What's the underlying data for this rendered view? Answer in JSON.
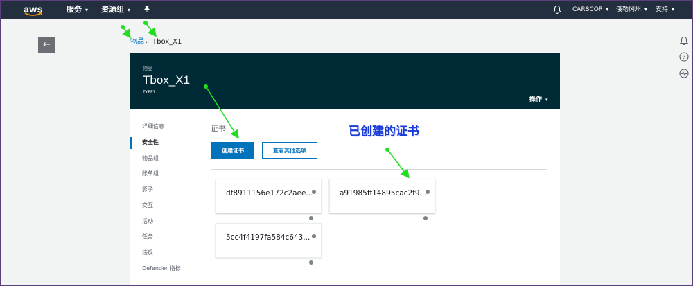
{
  "nav": {
    "logo_text": "aws",
    "services": "服务",
    "resource_groups": "资源组",
    "account": "CARSCOP",
    "region": "俄勒冈州",
    "support": "支持"
  },
  "breadcrumb": {
    "parent": "物品",
    "separator": "›",
    "current": "Tbox_X1"
  },
  "header": {
    "label": "物品",
    "title": "Tbox_X1",
    "type": "TYPE1",
    "actions": "操作"
  },
  "sidebar": {
    "items": [
      {
        "label": "详细信息"
      },
      {
        "label": "安全性"
      },
      {
        "label": "物品组"
      },
      {
        "label": "账单组"
      },
      {
        "label": "影子"
      },
      {
        "label": "交互"
      },
      {
        "label": "活动"
      },
      {
        "label": "任务"
      },
      {
        "label": "违反"
      },
      {
        "label": "Defender 指标"
      }
    ]
  },
  "certificates": {
    "title": "证书",
    "create_button": "创建证书",
    "more_options_button": "查看其他选项",
    "items": [
      {
        "id": "df8911156e172c2aee..."
      },
      {
        "id": "a91985ff14895cac2f9..."
      },
      {
        "id": "5cc4f4197fa584c643..."
      }
    ]
  },
  "annotation": {
    "text": "已创建的证书",
    "color": "#1a3bd6"
  },
  "colors": {
    "nav_bg": "#232f3e",
    "header_bg": "#002b36",
    "primary": "#0073bb",
    "arrow": "#22dd22"
  }
}
